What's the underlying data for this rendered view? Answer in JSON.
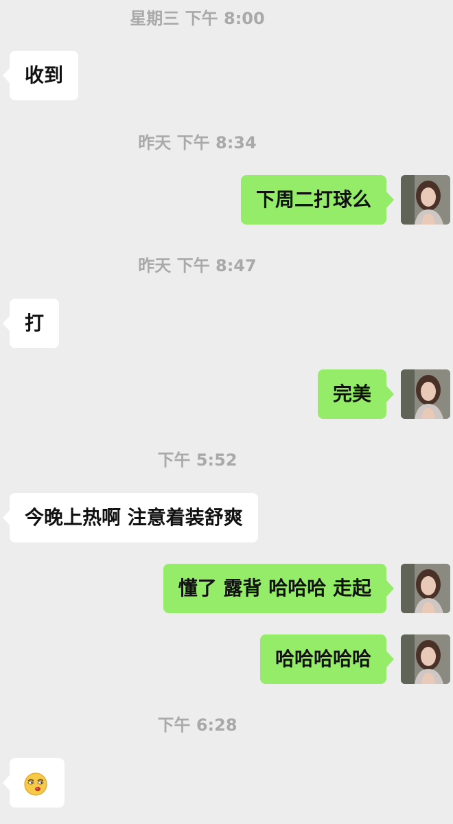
{
  "chat": {
    "timestamps": [
      "星期三 下午 8:00",
      "昨天 下午 8:34",
      "昨天 下午 8:47",
      "下午 5:52",
      "下午 6:28"
    ],
    "messages": [
      {
        "side": "incoming",
        "text": "收到"
      },
      {
        "side": "outgoing",
        "text": "下周二打球么"
      },
      {
        "side": "incoming",
        "text": "打"
      },
      {
        "side": "outgoing",
        "text": "完美"
      },
      {
        "side": "incoming",
        "text": "今晚上热啊 注意着装舒爽"
      },
      {
        "side": "outgoing",
        "text": "懂了 露背 哈哈哈 走起"
      },
      {
        "side": "outgoing",
        "text": "哈哈哈哈哈"
      },
      {
        "side": "incoming",
        "text": "",
        "emoji": "smirk-sunglasses-emoji"
      }
    ]
  },
  "colors": {
    "background": "#ededed",
    "incoming_bubble": "#ffffff",
    "outgoing_bubble": "#95ec69",
    "timestamp_text": "#a9a9a9"
  },
  "icons": {
    "avatar": "profile-photo-avatar",
    "sticker": "smirk-emoji"
  }
}
